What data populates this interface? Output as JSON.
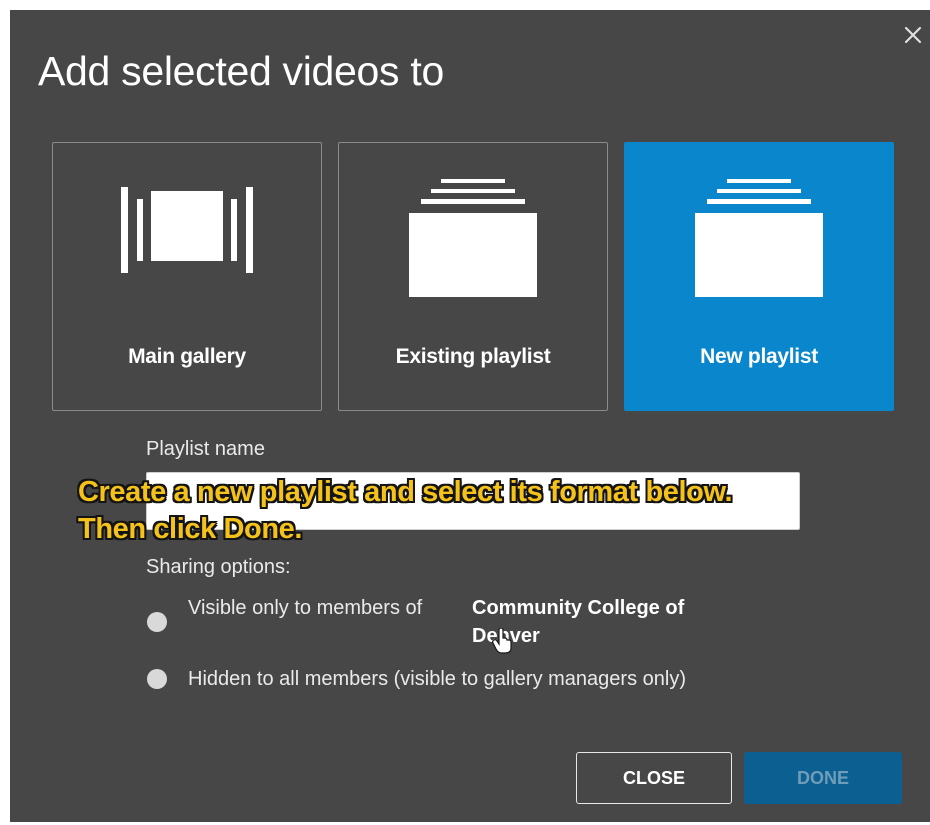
{
  "dialog": {
    "title": "Add selected videos to",
    "close_icon": "close-icon"
  },
  "tiles": [
    {
      "label": "Main gallery",
      "icon": "gallery-icon",
      "selected": false
    },
    {
      "label": "Existing playlist",
      "icon": "playlist-stack-icon",
      "selected": false
    },
    {
      "label": "New playlist",
      "icon": "playlist-stack-icon",
      "selected": true
    }
  ],
  "form": {
    "playlist_name_label": "Playlist name",
    "playlist_name_value": "",
    "sharing_label": "Sharing options:",
    "options": [
      {
        "text": "Visible only to members of",
        "org": "Community College of Denver"
      },
      {
        "text": "Hidden to all members (visible to gallery managers only)"
      }
    ]
  },
  "overlay": {
    "line1": "Create a new playlist and select its format below.",
    "line2": "Then click Done."
  },
  "buttons": {
    "close_label": "CLOSE",
    "done_label": "DONE"
  },
  "colors": {
    "dialog_bg": "#474747",
    "selected_tile": "#0a86cc",
    "done_button": "#0b5f91",
    "overlay_text": "#f5c21a"
  }
}
